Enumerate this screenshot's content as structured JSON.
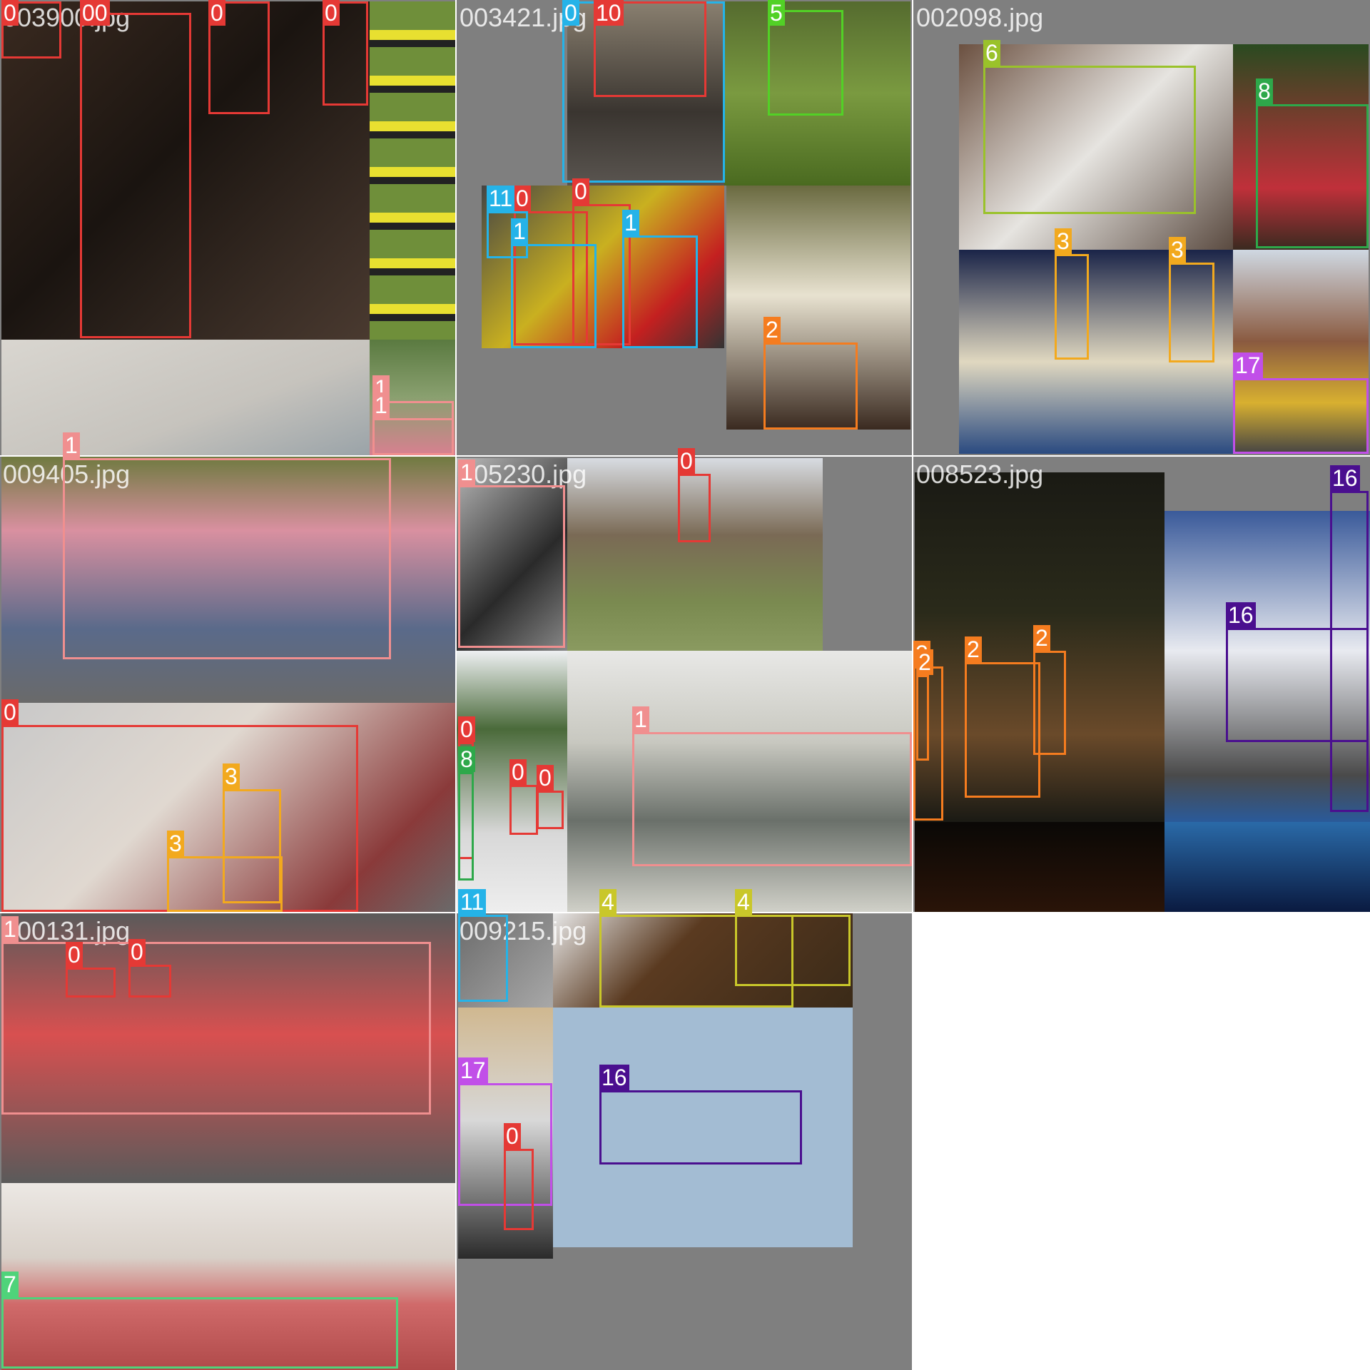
{
  "grid": {
    "tiles": [
      {
        "name": "003900.jpg"
      },
      {
        "name": "003421.jpg"
      },
      {
        "name": "002098.jpg"
      },
      {
        "name": "009405.jpg"
      },
      {
        "name": "005230.jpg"
      },
      {
        "name": "008523.jpg"
      },
      {
        "name": "100131.jpg"
      },
      {
        "name": "009215.jpg"
      }
    ]
  },
  "class_colors": {
    "0": "#e53935",
    "1": "#f08f8f",
    "2": "#f57c1f",
    "3": "#f2a91e",
    "4": "#c9c72a",
    "5": "#52d126",
    "6": "#9ac22a",
    "7": "#4fd37a",
    "8": "#2ea84a",
    "11": "#25b3e8",
    "16": "#4a0f8f",
    "17": "#c14fe8"
  },
  "detections": [
    {
      "tile": 0,
      "label": "0"
    },
    {
      "tile": 0,
      "label": "00"
    },
    {
      "tile": 0,
      "label": "0"
    },
    {
      "tile": 0,
      "label": "0"
    },
    {
      "tile": 0,
      "label": "1"
    },
    {
      "tile": 0,
      "label": "1"
    },
    {
      "tile": 1,
      "label": "0"
    },
    {
      "tile": 1,
      "label": "10"
    },
    {
      "tile": 1,
      "label": "5"
    },
    {
      "tile": 1,
      "label": "0"
    },
    {
      "tile": 1,
      "label": "0"
    },
    {
      "tile": 1,
      "label": "11"
    },
    {
      "tile": 1,
      "label": "1"
    },
    {
      "tile": 1,
      "label": "1"
    },
    {
      "tile": 1,
      "label": "2"
    },
    {
      "tile": 2,
      "label": "6"
    },
    {
      "tile": 2,
      "label": "8"
    },
    {
      "tile": 2,
      "label": "3"
    },
    {
      "tile": 2,
      "label": "3"
    },
    {
      "tile": 2,
      "label": "17"
    },
    {
      "tile": 3,
      "label": "1"
    },
    {
      "tile": 3,
      "label": "0"
    },
    {
      "tile": 3,
      "label": "3"
    },
    {
      "tile": 3,
      "label": "3"
    },
    {
      "tile": 4,
      "label": "1"
    },
    {
      "tile": 4,
      "label": "0"
    },
    {
      "tile": 4,
      "label": "0"
    },
    {
      "tile": 4,
      "label": "8"
    },
    {
      "tile": 4,
      "label": "0"
    },
    {
      "tile": 4,
      "label": "0"
    },
    {
      "tile": 4,
      "label": "1"
    },
    {
      "tile": 5,
      "label": "2"
    },
    {
      "tile": 5,
      "label": "2"
    },
    {
      "tile": 5,
      "label": "2"
    },
    {
      "tile": 5,
      "label": "2"
    },
    {
      "tile": 5,
      "label": "16"
    },
    {
      "tile": 5,
      "label": "16"
    },
    {
      "tile": 6,
      "label": "1"
    },
    {
      "tile": 6,
      "label": "0"
    },
    {
      "tile": 6,
      "label": "0"
    },
    {
      "tile": 6,
      "label": "7"
    },
    {
      "tile": 7,
      "label": "11"
    },
    {
      "tile": 7,
      "label": "4"
    },
    {
      "tile": 7,
      "label": "4"
    },
    {
      "tile": 7,
      "label": "17"
    },
    {
      "tile": 7,
      "label": "0"
    },
    {
      "tile": 7,
      "label": "16"
    }
  ]
}
